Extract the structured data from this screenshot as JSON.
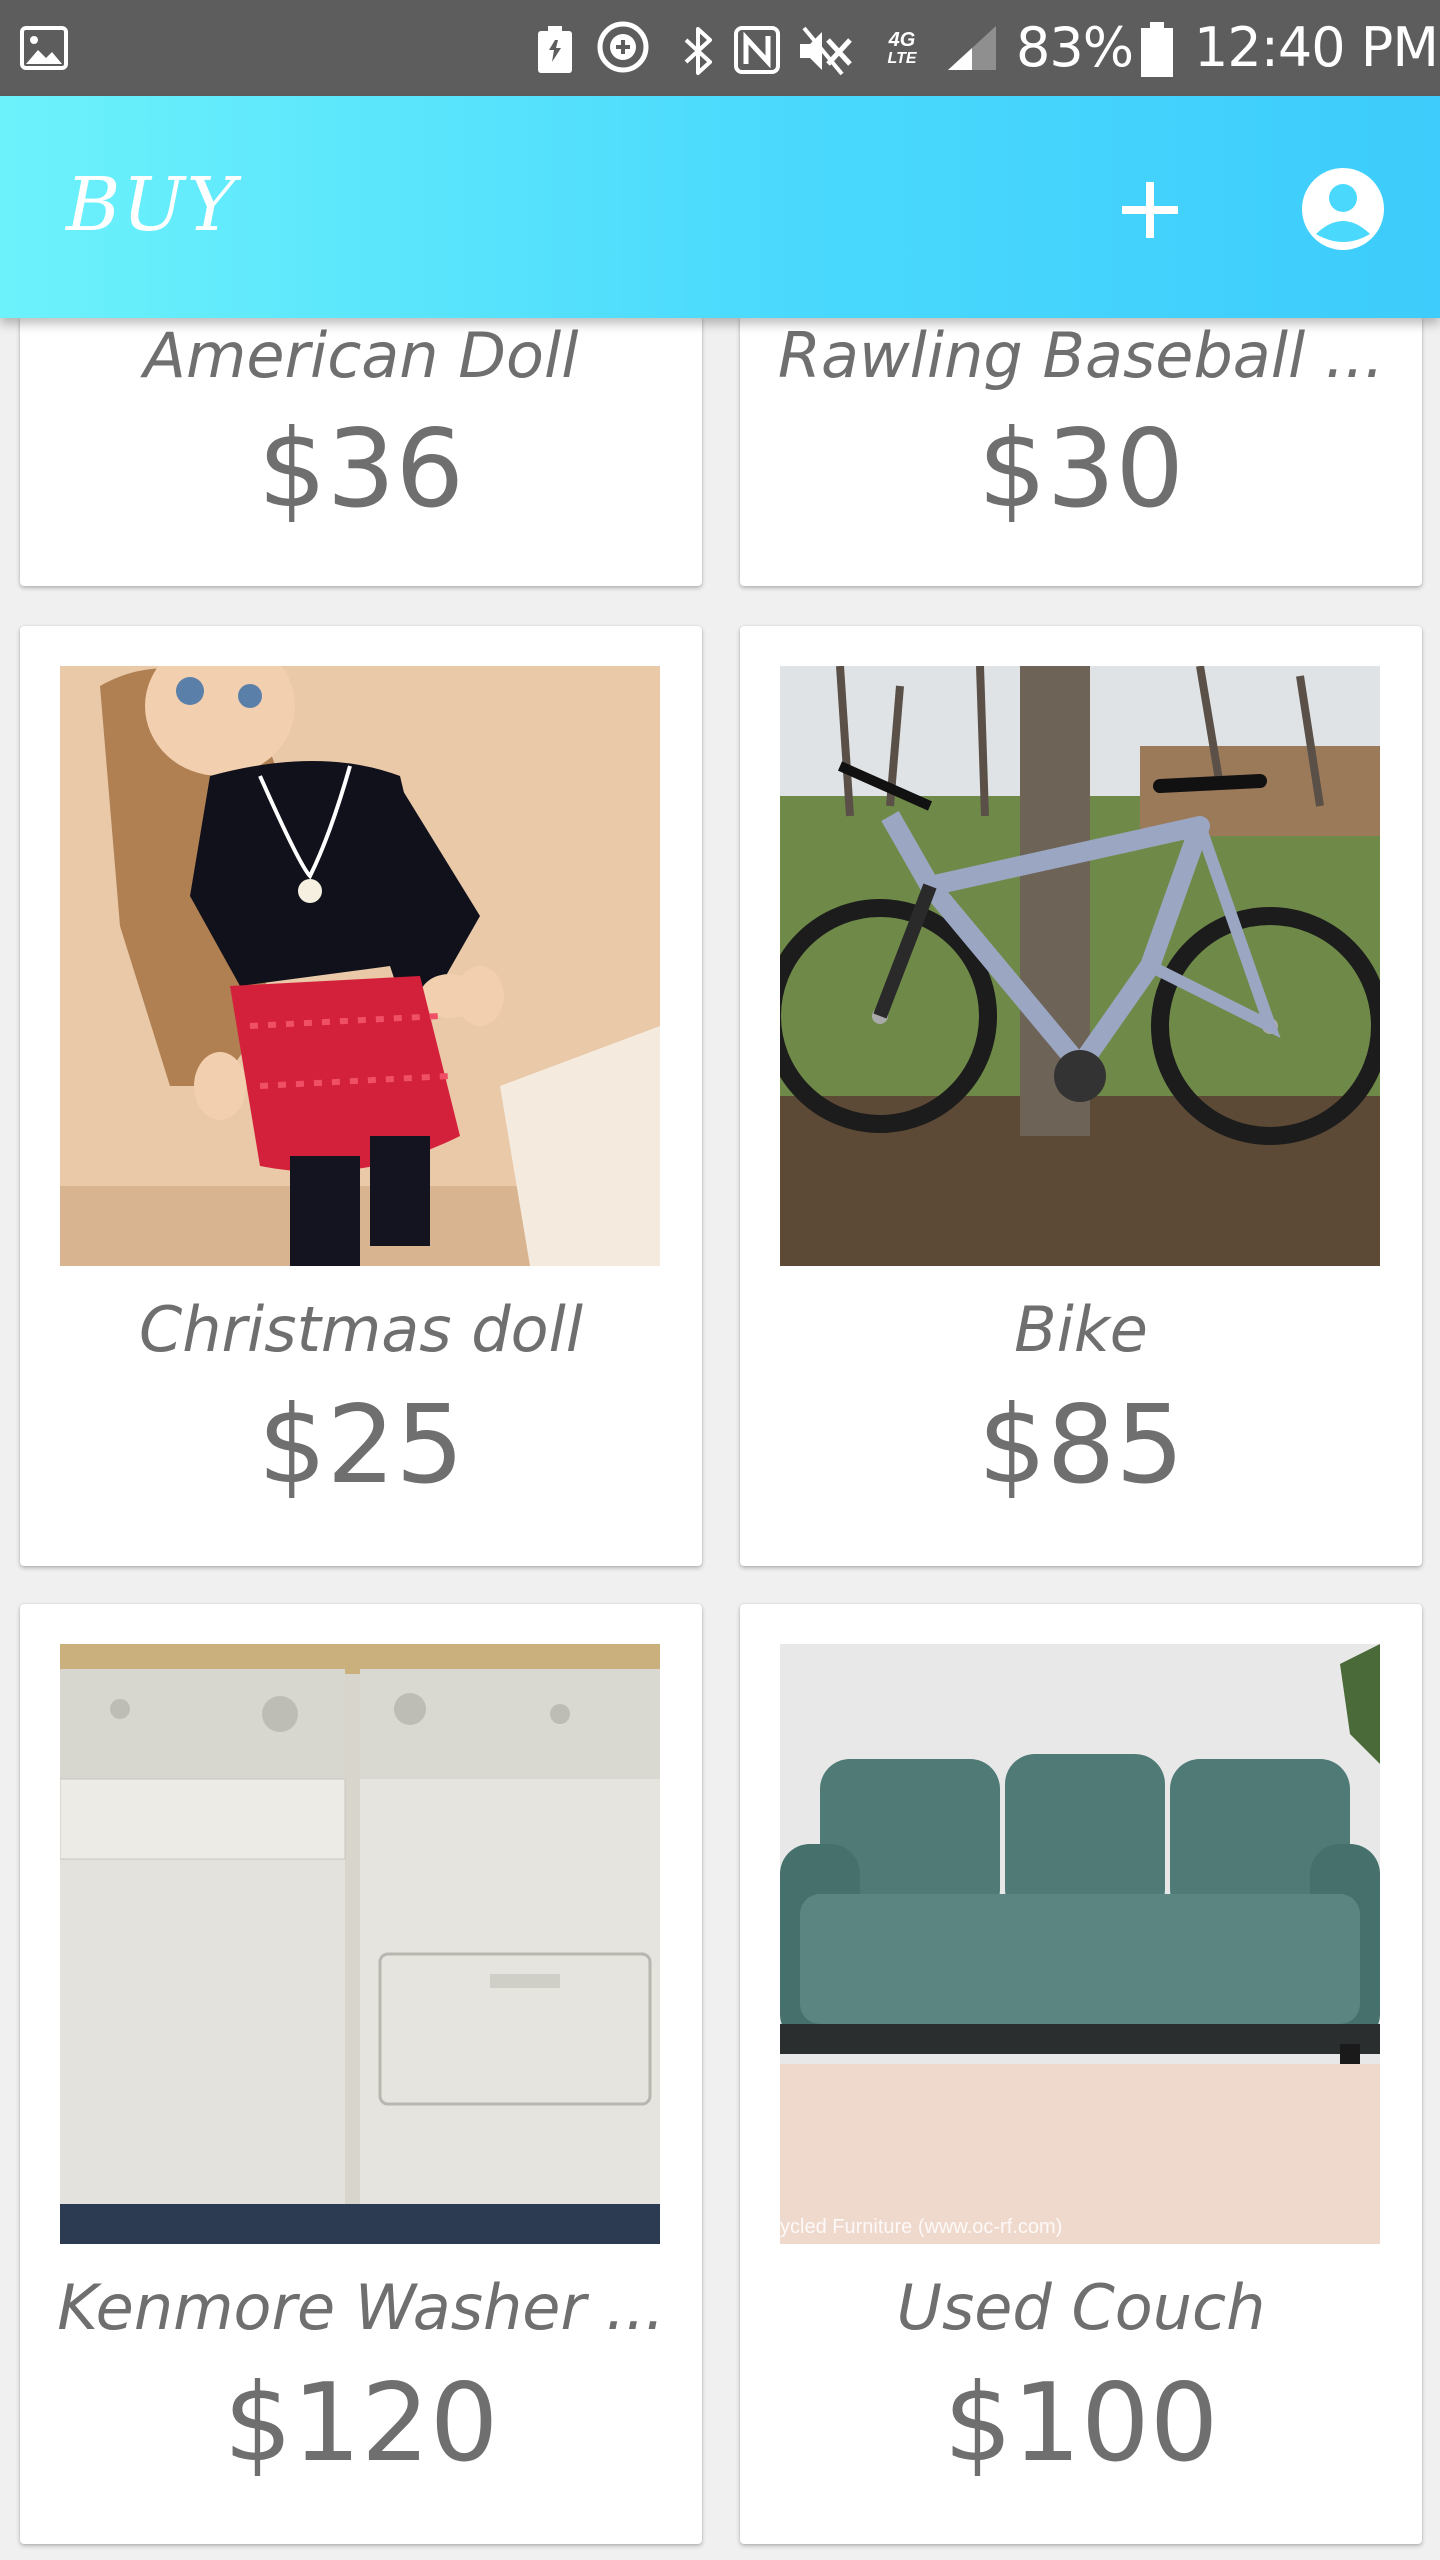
{
  "status_bar": {
    "network_type": [
      "4G",
      "LTE"
    ],
    "battery": "83%",
    "time": "12:40 PM",
    "icons": [
      "gallery-icon",
      "battery-saver-icon",
      "sync-icon",
      "bluetooth-icon",
      "nfc-icon",
      "mute-icon",
      "signal-icon",
      "battery-icon"
    ]
  },
  "app_bar": {
    "title": "BUY",
    "background_colors": [
      "#6cf2fb",
      "#3dccfb"
    ],
    "actions": [
      "add-icon",
      "account-icon"
    ]
  },
  "products": [
    {
      "name": "American Doll",
      "price": "$36"
    },
    {
      "name": "Rawling Baseball ...",
      "price": "$30"
    },
    {
      "name": "Christmas doll",
      "price": "$25"
    },
    {
      "name": "Bike",
      "price": "$85"
    },
    {
      "name": "Kenmore Washer ...",
      "price": "$120"
    },
    {
      "name": "Used Couch",
      "price": "$100",
      "photo_caption": "ycled Furniture (www.oc-rf.com)"
    }
  ]
}
